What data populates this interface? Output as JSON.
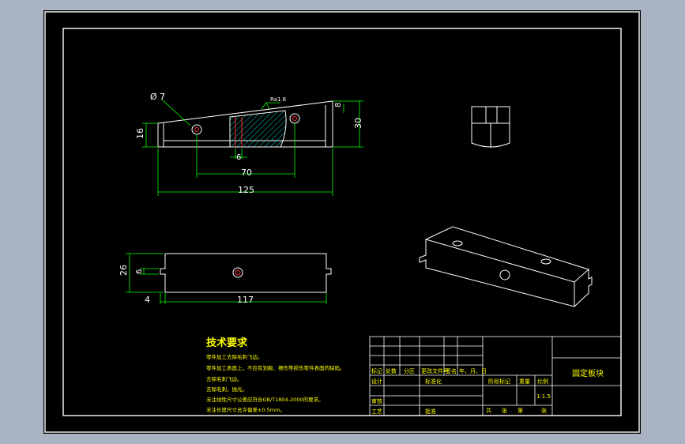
{
  "colors": {
    "background_frame": "#a9b3c2",
    "canvas": "#000000",
    "geometry": "#ffffff",
    "dimension": "#00ff00",
    "text": "#ffff00",
    "hatch": "#00c8c8",
    "hole_red": "#ff3030"
  },
  "dimensions": {
    "dia": "Ø 7",
    "roughness": "Ra1.6",
    "d8": "8",
    "d30": "30",
    "d16": "16",
    "d6_top": "6",
    "d70": "70",
    "d125": "125",
    "d26": "26",
    "d6_side": "6",
    "d4": "4",
    "d117": "117"
  },
  "tech": {
    "title": "技术要求",
    "lines": [
      "零件加工去除毛刺飞边。",
      "零件加工表面上，不应有划痕、擦伤等损伤零件表面的缺陷。",
      "去除毛刺飞边。",
      "去除毛刺，抛光。",
      "未注线性尺寸公差应符合GB/T1804-2000的要求。",
      "未注长度尺寸允许偏差±0.5mm。"
    ]
  },
  "title_block": {
    "part_name": "固定板块",
    "scale": "1:1.5",
    "row_headers": [
      "标记",
      "处数",
      "分区",
      "更改文件号",
      "签名",
      "年、月、日"
    ],
    "design": "设计",
    "standard": "标准化",
    "review": "审核",
    "process": "工艺",
    "approve": "批准",
    "stage_mark": "阶段标记",
    "weight": "重量",
    "ratio": "比例",
    "sheets_total": "共",
    "sheet_label": "张",
    "sheet_no": "第",
    "sheet_label2": "张"
  }
}
